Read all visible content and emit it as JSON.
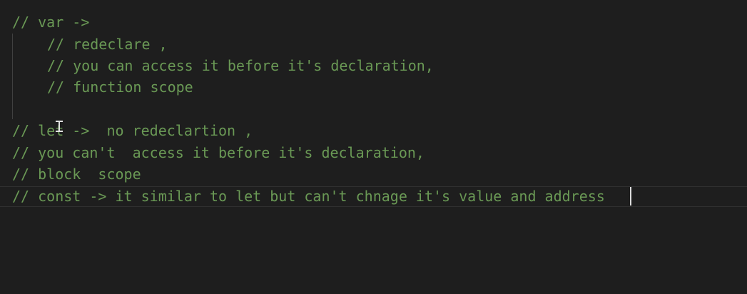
{
  "editor": {
    "lines": [
      "// var ->",
      "// redeclare ,",
      "// you can access it before it's declaration,",
      "// function scope",
      "",
      "// let ->  no redeclartion ,",
      "// you can't  access it before it's declaration,",
      "// block  scope",
      "// const -> it similar to let but can't chnage it's value and address"
    ]
  },
  "colors": {
    "background": "#1e1e1e",
    "comment": "#6a9955",
    "indent_guide": "#404040",
    "caret": "#dcdcdc"
  }
}
